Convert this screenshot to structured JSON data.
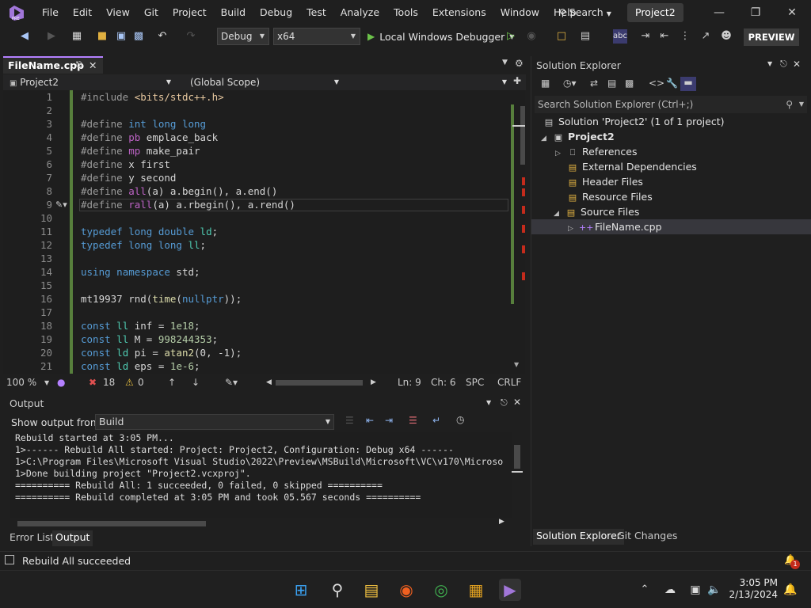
{
  "menu": [
    "File",
    "Edit",
    "View",
    "Git",
    "Project",
    "Build",
    "Debug",
    "Test",
    "Analyze",
    "Tools",
    "Extensions",
    "Window",
    "Help"
  ],
  "search_label": "Search",
  "project_badge": "Project2",
  "toolbar": {
    "config": "Debug",
    "platform": "x64",
    "run_label": "Local Windows Debugger",
    "preview": "PREVIEW"
  },
  "editor": {
    "tab": "FileName.cpp",
    "project_combo": "Project2",
    "scope_combo": "(Global Scope)",
    "lines": [
      {
        "n": "1",
        "text": "#include <bits/stdc++.h>"
      },
      {
        "n": "2",
        "text": ""
      },
      {
        "n": "3",
        "text": "#define int long long"
      },
      {
        "n": "4",
        "text": "#define pb emplace_back"
      },
      {
        "n": "5",
        "text": "#define mp make_pair"
      },
      {
        "n": "6",
        "text": "#define x first"
      },
      {
        "n": "7",
        "text": "#define y second"
      },
      {
        "n": "8",
        "text": "#define all(a) a.begin(), a.end()"
      },
      {
        "n": "9",
        "text": "#define rall(a) a.rbegin(), a.rend()"
      },
      {
        "n": "10",
        "text": ""
      },
      {
        "n": "11",
        "text": "typedef long double ld;"
      },
      {
        "n": "12",
        "text": "typedef long long ll;"
      },
      {
        "n": "13",
        "text": ""
      },
      {
        "n": "14",
        "text": "using namespace std;"
      },
      {
        "n": "15",
        "text": ""
      },
      {
        "n": "16",
        "text": "mt19937 rnd(time(nullptr));"
      },
      {
        "n": "17",
        "text": ""
      },
      {
        "n": "18",
        "text": "const ll inf = 1e18;"
      },
      {
        "n": "19",
        "text": "const ll M = 998244353;"
      },
      {
        "n": "20",
        "text": "const ld pi = atan2(0, -1);"
      },
      {
        "n": "21",
        "text": "const ld eps = 1e-6;"
      }
    ]
  },
  "editor_status": {
    "zoom": "100 %",
    "errors": "18",
    "warnings": "0",
    "line": "Ln: 9",
    "col": "Ch: 6",
    "spc": "SPC",
    "eol": "CRLF"
  },
  "output": {
    "title": "Output",
    "show_from_label": "Show output from:",
    "source": "Build",
    "lines": [
      "Rebuild started at 3:05 PM...",
      "1>------ Rebuild All started: Project: Project2, Configuration: Debug x64 ------",
      "1>C:\\Program Files\\Microsoft Visual Studio\\2022\\Preview\\MSBuild\\Microsoft\\VC\\v170\\Microso",
      "1>Done building project \"Project2.vcxproj\".",
      "========== Rebuild All: 1 succeeded, 0 failed, 0 skipped ==========",
      "========== Rebuild completed at 3:05 PM and took 05.567 seconds =========="
    ]
  },
  "bottom_tabs": [
    "Error List",
    "Output"
  ],
  "solution": {
    "title": "Solution Explorer",
    "search_placeholder": "Search Solution Explorer (Ctrl+;)",
    "root": "Solution 'Project2' (1 of 1 project)",
    "project": "Project2",
    "items": [
      "References",
      "External Dependencies",
      "Header Files",
      "Resource Files",
      "Source Files"
    ],
    "file": "FileName.cpp",
    "tabs": [
      "Solution Explorer",
      "Git Changes"
    ]
  },
  "status_text": "Rebuild All succeeded",
  "clock": {
    "time": "3:05 PM",
    "date": "2/13/2024"
  },
  "notification_count": "1",
  "colors": {
    "accent": "#b480ff",
    "keyword": "#569cd6",
    "macro": "#bd63c5",
    "type": "#4ec9b0",
    "string": "#e8c9a0"
  }
}
